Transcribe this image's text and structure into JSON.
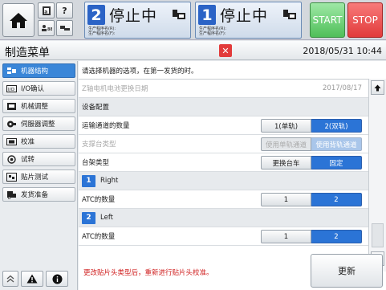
{
  "topbar": {
    "lanes": [
      {
        "number": "2",
        "status": "停止中",
        "info_line1": "生产程序名(R):",
        "info_line2": "生产程序名(F):"
      },
      {
        "number": "1",
        "status": "停止中",
        "info_line1": "生产程序名(R):",
        "info_line2": "生产程序名(F):"
      }
    ],
    "help_label": "?",
    "start_label": "START",
    "stop_label": "STOP"
  },
  "header": {
    "title": "制造菜单",
    "datetime": "2018/05/31 10:44"
  },
  "sidebar": {
    "items": [
      {
        "label": "机器结构",
        "icon": "machine-structure-icon",
        "active": true
      },
      {
        "label": "I/O确认",
        "icon": "io-icon",
        "active": false
      },
      {
        "label": "机械调整",
        "icon": "mechanical-adjust-icon",
        "active": false
      },
      {
        "label": "伺服器调整",
        "icon": "servo-icon",
        "active": false
      },
      {
        "label": "校准",
        "icon": "calibration-icon",
        "active": false
      },
      {
        "label": "试转",
        "icon": "trial-run-icon",
        "active": false
      },
      {
        "label": "贴片测试",
        "icon": "mount-test-icon",
        "active": false
      },
      {
        "label": "发货准备",
        "icon": "shipping-icon",
        "active": false
      }
    ]
  },
  "main": {
    "hint": "请选择机器的选项，在第一发货的时。",
    "rows": {
      "z_battery": {
        "label": "Z轴电机电池更换日期",
        "value": "2017/08/17"
      },
      "device_config": {
        "label": "设备配置"
      },
      "conveyor_count": {
        "label": "运输通道的数量",
        "opt1": "1(单轨)",
        "opt2": "2(双轨)"
      },
      "support_type": {
        "label": "支撑台类型",
        "opt1": "使用单轨通道",
        "opt2": "使用背轨通道"
      },
      "rack_type": {
        "label": "台架类型",
        "opt1": "更换台车",
        "opt2": "固定"
      },
      "lane1": {
        "number": "1",
        "name": "Right"
      },
      "atc1": {
        "label": "ATC的数量",
        "opt1": "1",
        "opt2": "2"
      },
      "lane2": {
        "number": "2",
        "name": "Left"
      },
      "atc2": {
        "label": "ATC的数量",
        "opt1": "1",
        "opt2": "2"
      }
    },
    "footer_message": "更改贴片头类型后，重新进行贴片头校准。",
    "update_label": "更新"
  },
  "colors": {
    "accent": "#2b74d6",
    "start": "#4fbf59",
    "stop": "#e23b3b",
    "warning_text": "#d02020"
  }
}
